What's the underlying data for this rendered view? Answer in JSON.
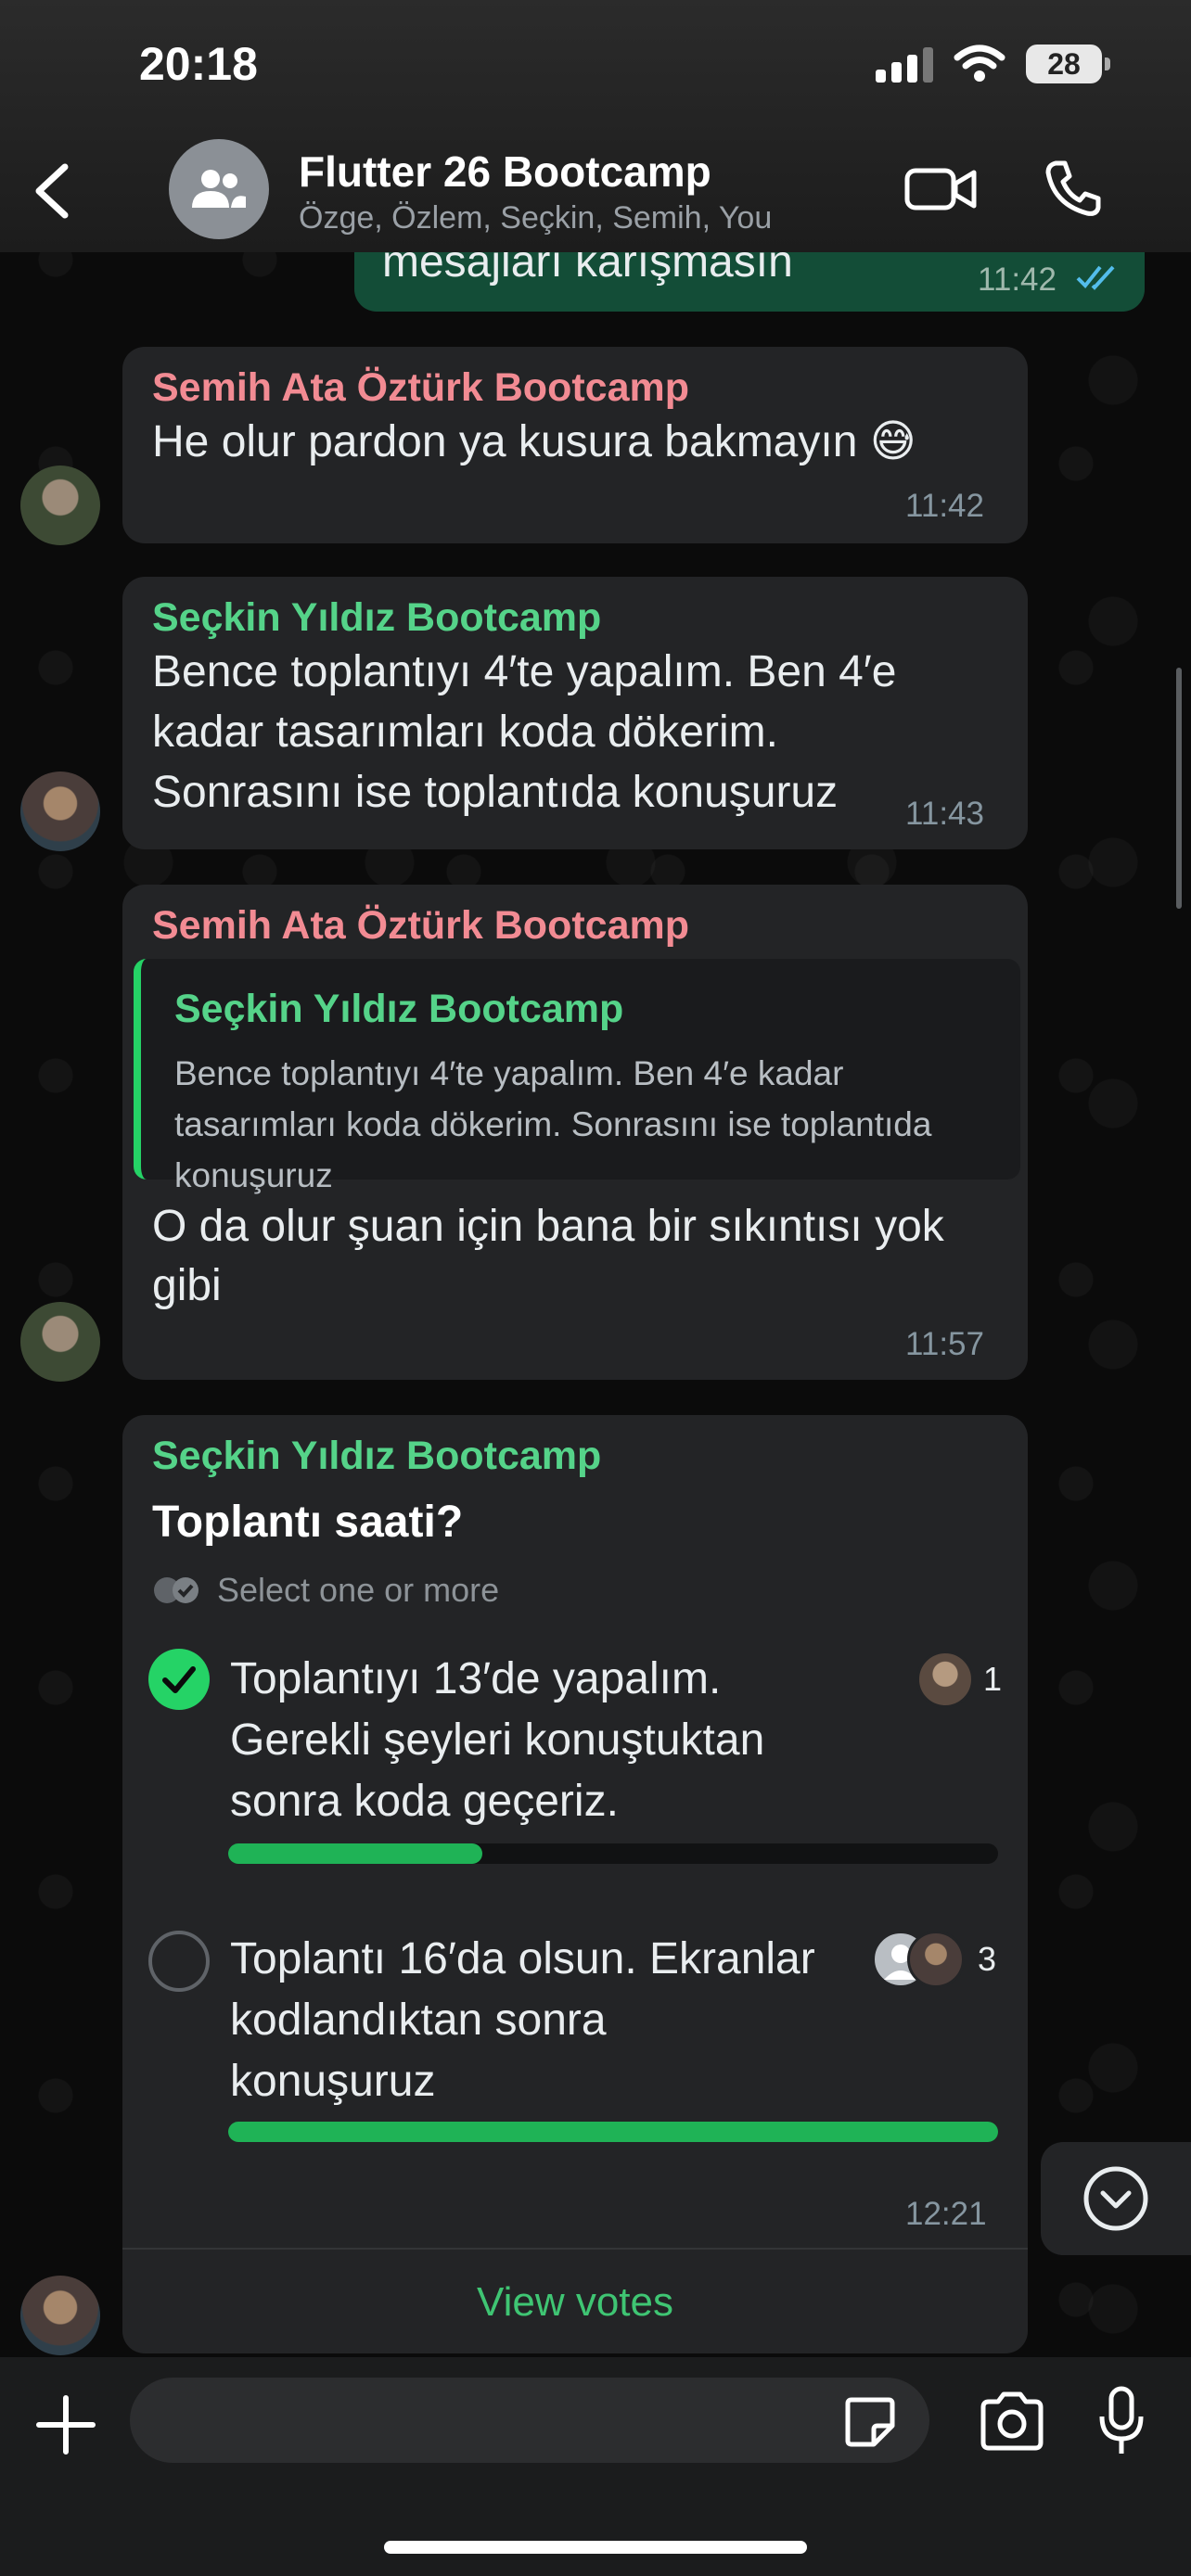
{
  "status_bar": {
    "time": "20:18",
    "battery": "28"
  },
  "header": {
    "title": "Flutter 26 Bootcamp",
    "subtitle": "Özge, Özlem, Seçkin, Semih, You"
  },
  "messages": [
    {
      "type": "outgoing",
      "text": "mesajları karışmasın",
      "time": "11:42"
    },
    {
      "type": "incoming",
      "sender": "Semih Ata Öztürk Bootcamp",
      "sender_color": "#f28b93",
      "text": "He olur pardon ya kusura bakmayın 😅",
      "time": "11:42"
    },
    {
      "type": "incoming",
      "sender": "Seçkin Yıldız Bootcamp",
      "sender_color": "#55d389",
      "lines": [
        "Bence toplantıyı 4′te yapalım. Ben 4′e",
        "kadar tasarımları koda dökerim.",
        "Sonrasını ise toplantıda konuşuruz"
      ],
      "time": "11:43"
    },
    {
      "type": "incoming-reply",
      "sender": "Semih Ata Öztürk Bootcamp",
      "sender_color": "#f28b93",
      "quote_sender": "Seçkin Yıldız Bootcamp",
      "quote_text": "Bence toplantıyı 4′te yapalım. Ben 4′e kadar tasarımları koda dökerim. Sonrasını ise toplantıda konuşuruz",
      "lines": [
        "O da olur şuan için bana bir sıkıntısı yok",
        "gibi"
      ],
      "time": "11:57"
    }
  ],
  "poll": {
    "sender": "Seçkin Yıldız Bootcamp",
    "question": "Toplantı saati?",
    "hint": "Select one or more",
    "options": [
      {
        "lines": [
          "Toplantıyı 13′de yapalım.",
          "Gerekli şeyleri konuştuktan",
          "sonra koda geçeriz."
        ],
        "votes": "1",
        "fraction": 0.33,
        "selected": true
      },
      {
        "lines": [
          "Toplantı 16′da olsun. Ekranlar",
          "kodlandıktan sonra",
          "konuşuruz"
        ],
        "votes": "3",
        "fraction": 1.0,
        "selected": false
      }
    ],
    "time": "12:21",
    "view_votes": "View votes"
  },
  "composer": {
    "value": "",
    "placeholder": ""
  },
  "colors": {
    "accent": "#25d366",
    "outgoing_bubble": "#134d37",
    "incoming_bubble": "#232426"
  },
  "icons": [
    "back-chevron-icon",
    "group-icon",
    "video-call-icon",
    "phone-icon",
    "double-check-icon",
    "check-icon",
    "chevron-down-icon",
    "plus-icon",
    "sticker-icon",
    "camera-icon",
    "mic-icon"
  ]
}
